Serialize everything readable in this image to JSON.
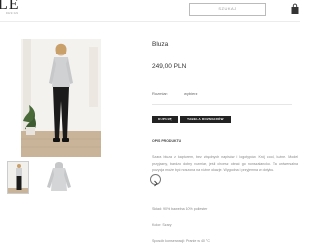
{
  "header": {
    "logo": "LE",
    "logo_sub": "DESIGN",
    "search_placeholder": "SZUKAJ",
    "cart_icon": "shopping-bag-icon"
  },
  "product": {
    "title": "Bluza",
    "price": "249,00 PLN",
    "size_label": "Rozmiar:",
    "size_value": "wybierz",
    "buy_label": "KUPUJĘ",
    "size_table_label": "TABELA ROZMIARÓW",
    "description_heading": "OPIS PRODUKTU",
    "description": "Szara bluza z kapturem, bez zbędnych napisów i logotypów. Krój cool, luźne. Model przyjazny, bardzo dobry rozmiar, jeśli chcesz obrać go nonszalancko. Ta uniwersalna pozycja może być noszona na różne okazje. Wygodna i przyjemna w dotyku.",
    "composition": "Skład: 90% bawełna 10% poliester",
    "color": "Kolor: Szary",
    "care": "Sposób konserwacji: Pranie w 40 °C"
  },
  "gallery": {
    "next_icon": "chevron-right-icon"
  },
  "colors": {
    "button_bg": "#222222",
    "button_text": "#ffffff"
  }
}
